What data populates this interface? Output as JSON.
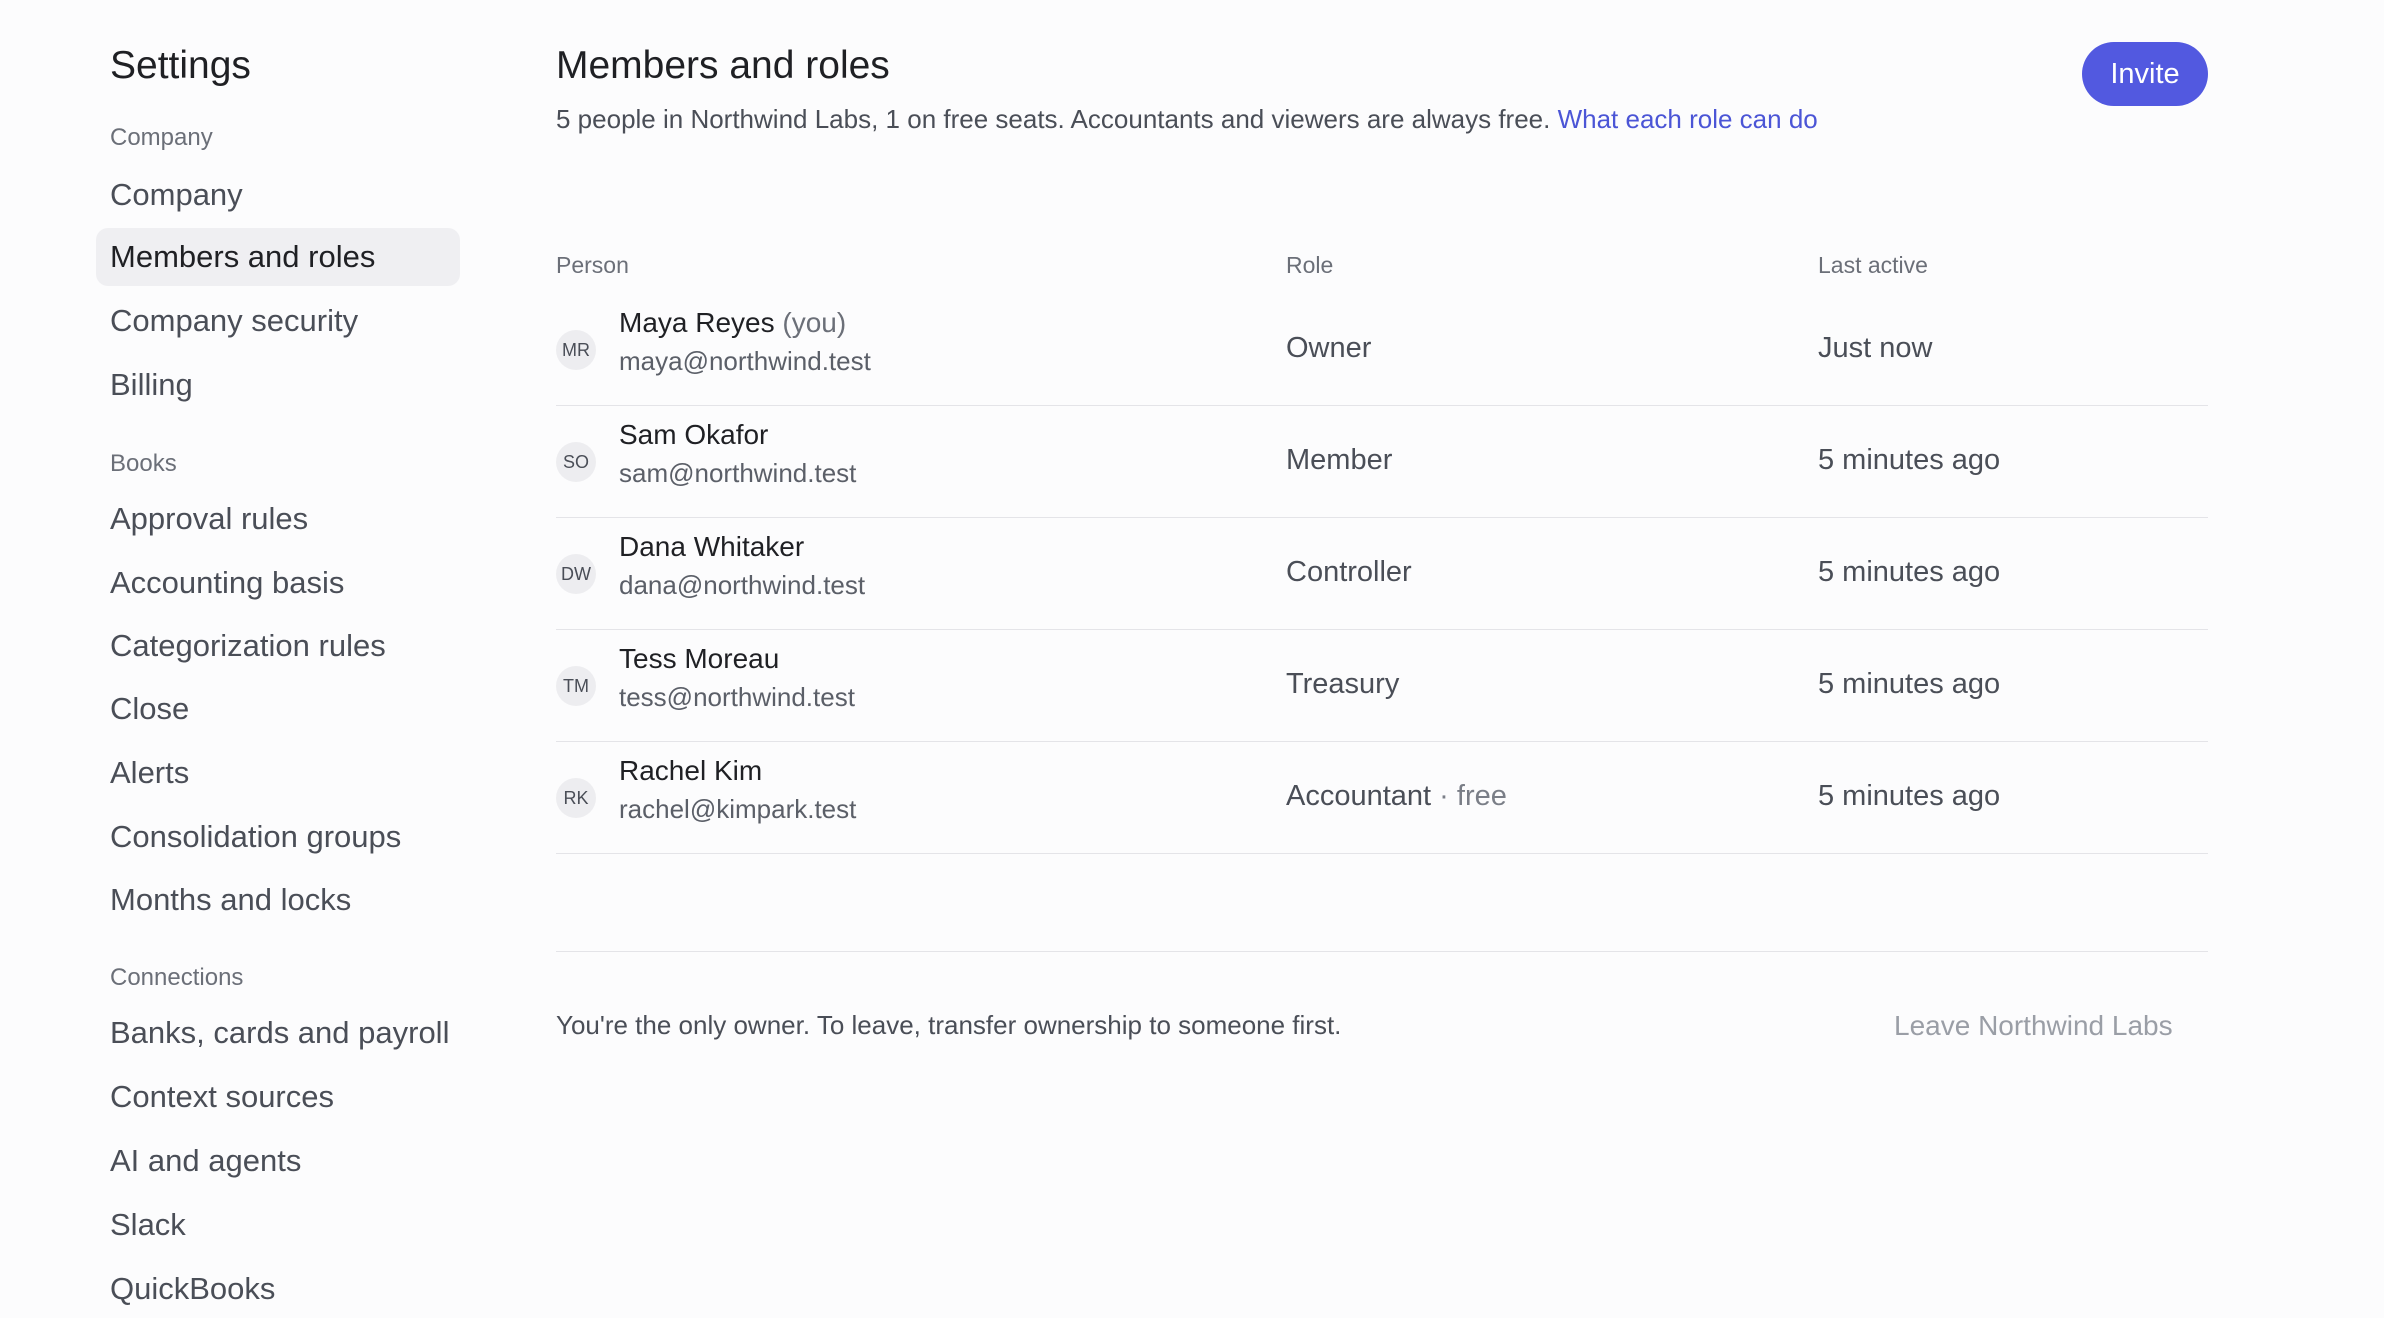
{
  "sidebar": {
    "title": "Settings",
    "sections": [
      {
        "label": "Company",
        "items": [
          "Company",
          "Members and roles",
          "Company security",
          "Billing"
        ]
      },
      {
        "label": "Books",
        "items": [
          "Approval rules",
          "Accounting basis",
          "Categorization rules",
          "Close",
          "Alerts",
          "Consolidation groups",
          "Months and locks"
        ]
      },
      {
        "label": "Connections",
        "items": [
          "Banks, cards and payroll",
          "Context sources",
          "AI and agents",
          "Slack",
          "QuickBooks"
        ]
      }
    ],
    "active_item": "Members and roles"
  },
  "main": {
    "title": "Members and roles",
    "subtitle": "5 people in Northwind Labs, 1 on free seats. Accountants and viewers are always free.",
    "subtitle_link": "What each role can do",
    "invite_label": "Invite",
    "columns": [
      "Person",
      "Role",
      "Last active"
    ],
    "members": [
      {
        "initials": "MR",
        "name": "Maya Reyes",
        "suffix": "(you)",
        "email": "maya@northwind.test",
        "role": "Owner",
        "role_note": "",
        "last_active": "Just now"
      },
      {
        "initials": "SO",
        "name": "Sam Okafor",
        "suffix": "",
        "email": "sam@northwind.test",
        "role": "Member",
        "role_note": "",
        "last_active": "5 minutes ago"
      },
      {
        "initials": "DW",
        "name": "Dana Whitaker",
        "suffix": "",
        "email": "dana@northwind.test",
        "role": "Controller",
        "role_note": "",
        "last_active": "5 minutes ago"
      },
      {
        "initials": "TM",
        "name": "Tess Moreau",
        "suffix": "",
        "email": "tess@northwind.test",
        "role": "Treasury",
        "role_note": "",
        "last_active": "5 minutes ago"
      },
      {
        "initials": "RK",
        "name": "Rachel Kim",
        "suffix": "",
        "email": "rachel@kimpark.test",
        "role": "Accountant",
        "role_note": "· free",
        "last_active": "5 minutes ago"
      }
    ],
    "footer_note": "You're the only owner. To leave, transfer ownership to someone first.",
    "leave_label": "Leave Northwind Labs"
  }
}
